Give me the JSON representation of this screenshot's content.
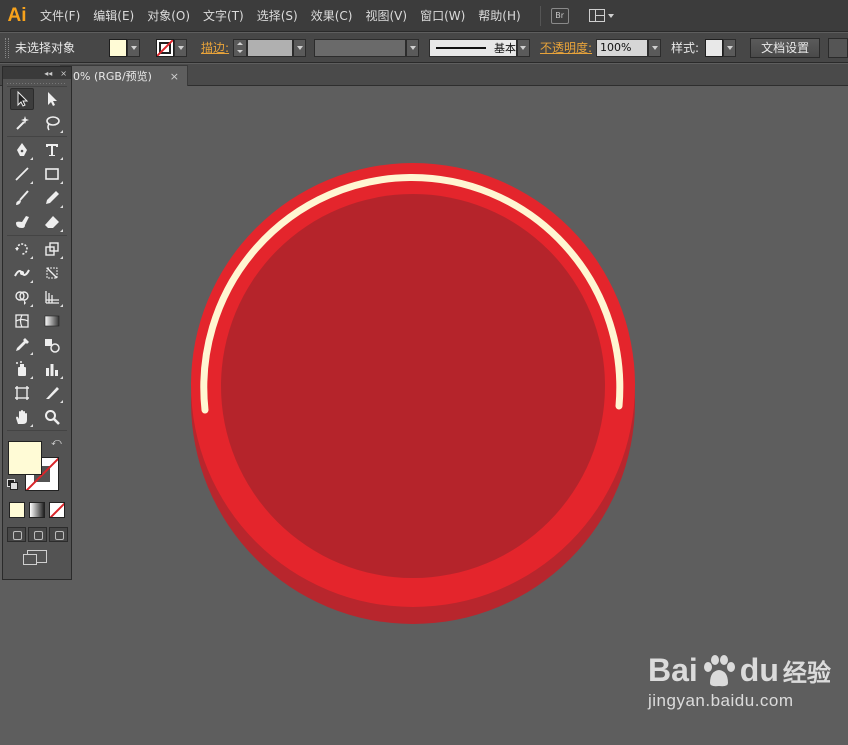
{
  "app": {
    "logo": "Ai"
  },
  "menu": [
    "文件(F)",
    "编辑(E)",
    "对象(O)",
    "文字(T)",
    "选择(S)",
    "效果(C)",
    "视图(V)",
    "窗口(W)",
    "帮助(H)"
  ],
  "bridge_label": "Br",
  "control": {
    "selection_label": "未选择对象",
    "stroke_link": "描边:",
    "stroke_style": "基本",
    "opacity_link": "不透明度:",
    "opacity_value": "100%",
    "style_label": "样式:",
    "doc_setup": "文档设置"
  },
  "tab": {
    "title": "0% (RGB/预览)",
    "close": "×"
  },
  "toolbox_head": {
    "collapse": "◂◂",
    "close": "×"
  },
  "colors": {
    "fill": "#fffbd6",
    "outer_ring": "#e4252c",
    "outer_shadow": "#b8262d",
    "inner_disc": "#b5242b",
    "highlight_arc": "#fff6d2",
    "canvas": "#5e5e5e"
  },
  "watermark": {
    "brand_a": "Bai",
    "brand_b": "du",
    "brand_cn": "经验",
    "url": "jingyan.baidu.com"
  }
}
